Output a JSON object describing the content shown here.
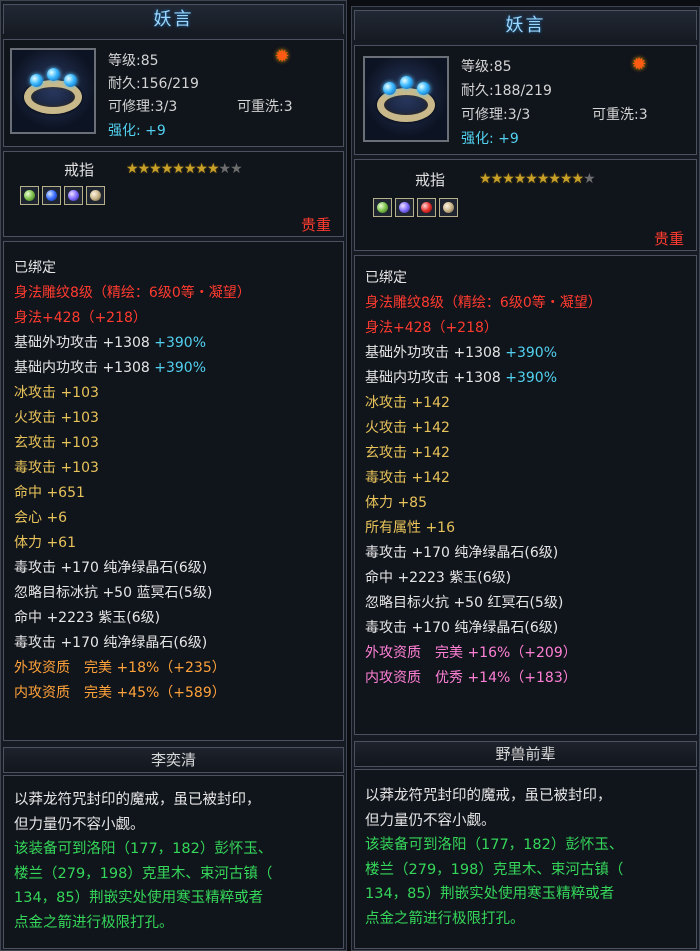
{
  "cards": [
    {
      "title": "妖言",
      "level_label": "等级:85",
      "durability_label": "耐久:156/219",
      "repair_label": "可修理:3/3",
      "rewash_label": "可重洗:3",
      "enhance_label": "强化:",
      "enhance_value": "+9",
      "type_label": "戒指",
      "stars_filled": 8,
      "stars_total": 10,
      "sockets": [
        "green-gem",
        "blue-gem",
        "violet-gem",
        "jade-gem"
      ],
      "rarity": "贵重",
      "stats": [
        {
          "text": "已绑定",
          "color": "white",
          "extra": ""
        },
        {
          "text": "身法雕纹8级（精绘：6级0等・凝望）",
          "color": "red",
          "extra": ""
        },
        {
          "text": "身法+428（+218）",
          "color": "red",
          "extra": ""
        },
        {
          "text": "基础外功攻击 +1308",
          "color": "white",
          "extra": "+390%"
        },
        {
          "text": "基础内功攻击 +1308",
          "color": "white",
          "extra": "+390%"
        },
        {
          "text": "冰攻击 +103",
          "color": "gold",
          "extra": ""
        },
        {
          "text": "火攻击 +103",
          "color": "gold",
          "extra": ""
        },
        {
          "text": "玄攻击 +103",
          "color": "gold",
          "extra": ""
        },
        {
          "text": "毒攻击 +103",
          "color": "gold",
          "extra": ""
        },
        {
          "text": "命中 +651",
          "color": "gold",
          "extra": ""
        },
        {
          "text": "会心 +6",
          "color": "gold",
          "extra": ""
        },
        {
          "text": "体力 +61",
          "color": "gold",
          "extra": ""
        },
        {
          "text": "毒攻击 +170 纯净绿晶石(6级)",
          "color": "white",
          "extra": ""
        },
        {
          "text": "忽略目标冰抗 +50 蓝冥石(5级)",
          "color": "white",
          "extra": ""
        },
        {
          "text": "命中 +2223 紫玉(6级)",
          "color": "white",
          "extra": ""
        },
        {
          "text": "毒攻击 +170 纯净绿晶石(6级)",
          "color": "white",
          "extra": ""
        },
        {
          "text": "外攻资质　完美 +18%（+235）",
          "color": "orange",
          "extra": ""
        },
        {
          "text": "内攻资质　完美 +45%（+589）",
          "color": "orange",
          "extra": ""
        }
      ],
      "author": "李奕清",
      "desc_white": [
        "以莽龙符咒封印的魔戒，虽已被封印，",
        "但力量仍不容小觑。"
      ],
      "desc_green": [
        "该装备可到洛阳（177，182）彭怀玉、",
        "楼兰（279，198）克里木、束河古镇（",
        "134，85）荆嵌实处使用寒玉精粹或者",
        "点金之箭进行极限打孔。"
      ]
    },
    {
      "title": "妖言",
      "level_label": "等级:85",
      "durability_label": "耐久:188/219",
      "repair_label": "可修理:3/3",
      "rewash_label": "可重洗:3",
      "enhance_label": "强化:",
      "enhance_value": "+9",
      "type_label": "戒指",
      "stars_filled": 9,
      "stars_total": 10,
      "sockets": [
        "green-gem",
        "violet-gem",
        "red-gem",
        "jade-gem"
      ],
      "rarity": "贵重",
      "stats": [
        {
          "text": "已绑定",
          "color": "white",
          "extra": ""
        },
        {
          "text": "身法雕纹8级（精绘：6级0等・凝望）",
          "color": "red",
          "extra": ""
        },
        {
          "text": "身法+428（+218）",
          "color": "red",
          "extra": ""
        },
        {
          "text": "基础外功攻击 +1308",
          "color": "white",
          "extra": "+390%"
        },
        {
          "text": "基础内功攻击 +1308",
          "color": "white",
          "extra": "+390%"
        },
        {
          "text": "冰攻击 +142",
          "color": "gold",
          "extra": ""
        },
        {
          "text": "火攻击 +142",
          "color": "gold",
          "extra": ""
        },
        {
          "text": "玄攻击 +142",
          "color": "gold",
          "extra": ""
        },
        {
          "text": "毒攻击 +142",
          "color": "gold",
          "extra": ""
        },
        {
          "text": "体力 +85",
          "color": "gold",
          "extra": ""
        },
        {
          "text": "所有属性 +16",
          "color": "gold",
          "extra": ""
        },
        {
          "text": "毒攻击 +170 纯净绿晶石(6级)",
          "color": "white",
          "extra": ""
        },
        {
          "text": "命中 +2223 紫玉(6级)",
          "color": "white",
          "extra": ""
        },
        {
          "text": "忽略目标火抗 +50 红冥石(5级)",
          "color": "white",
          "extra": ""
        },
        {
          "text": "毒攻击 +170 纯净绿晶石(6级)",
          "color": "white",
          "extra": ""
        },
        {
          "text": "外攻资质　完美 +16%（+209）",
          "color": "pink",
          "extra": ""
        },
        {
          "text": "内攻资质　优秀 +14%（+183）",
          "color": "pink",
          "extra": ""
        }
      ],
      "author": "野兽前辈",
      "desc_white": [
        "以莽龙符咒封印的魔戒，虽已被封印，",
        "但力量仍不容小觑。"
      ],
      "desc_green": [
        "该装备可到洛阳（177，182）彭怀玉、",
        "楼兰（279，198）克里木、束河古镇（",
        "134，85）荆嵌实处使用寒玉精粹或者",
        "点金之箭进行极限打孔。"
      ]
    }
  ]
}
